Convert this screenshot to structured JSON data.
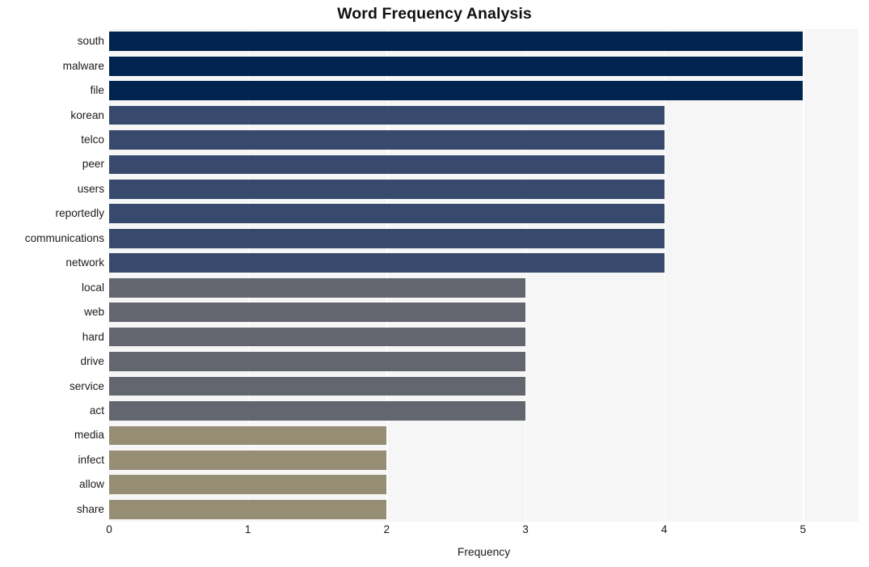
{
  "chart_data": {
    "type": "bar",
    "orientation": "horizontal",
    "title": "Word Frequency Analysis",
    "xlabel": "Frequency",
    "ylabel": "",
    "xlim": [
      0,
      5.4
    ],
    "xticks": [
      0,
      1,
      2,
      3,
      4,
      5
    ],
    "xtick_labels": [
      "0",
      "1",
      "2",
      "3",
      "4",
      "5"
    ],
    "grid": true,
    "grid_axis": "x",
    "legend": null,
    "categories": [
      "south",
      "malware",
      "file",
      "korean",
      "telco",
      "peer",
      "users",
      "reportedly",
      "communications",
      "network",
      "local",
      "web",
      "hard",
      "drive",
      "service",
      "act",
      "media",
      "infect",
      "allow",
      "share"
    ],
    "values": [
      5,
      5,
      5,
      4,
      4,
      4,
      4,
      4,
      4,
      4,
      3,
      3,
      3,
      3,
      3,
      3,
      2,
      2,
      2,
      2
    ],
    "bar_colors": [
      "#00244f",
      "#00244f",
      "#00244f",
      "#374a6e",
      "#374a6e",
      "#374a6e",
      "#374a6e",
      "#374a6e",
      "#374a6e",
      "#374a6e",
      "#63666e",
      "#63666e",
      "#63666e",
      "#63666e",
      "#63666e",
      "#63666e",
      "#958e75",
      "#958e75",
      "#958e75",
      "#958e75"
    ],
    "plot_background": "#f6f6f7",
    "figure_background": "#ffffff",
    "gridline_color": "#ffffff"
  }
}
